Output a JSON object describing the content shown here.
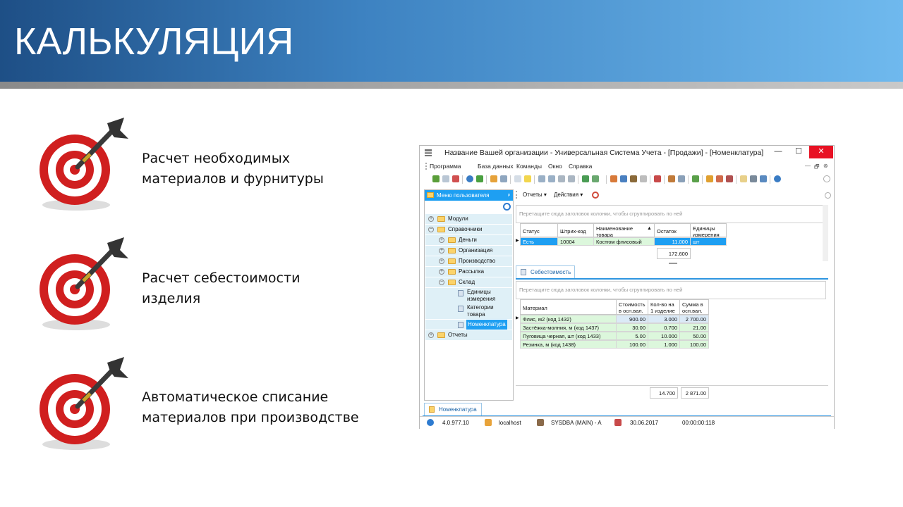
{
  "slide": {
    "title": "КАЛЬКУЛЯЦИЯ"
  },
  "bullets": [
    {
      "text": "Расчет необходимых\nматериалов и фурнитуры"
    },
    {
      "text": "Расчет себестоимости\nизделия"
    },
    {
      "text": "Автоматическое списание\nматериалов при производстве"
    }
  ],
  "app": {
    "title": "Название Вашей организации - Универсальная Система Учета - [Продажи] - [Номенклатура]",
    "window_buttons": {
      "minimize": "—",
      "maximize": "☐",
      "close": "✕"
    },
    "menu": [
      "Программа",
      "База данных",
      "Команды",
      "Окно",
      "Справка"
    ],
    "mdi_buttons": {
      "minimize": "—",
      "restore": "🗗",
      "close": "⊗"
    },
    "left_panel": {
      "header": "Меню пользователя",
      "pin": "ᵖ",
      "tree": [
        {
          "label": "Модули",
          "toggle": "+"
        },
        {
          "label": "Справочники",
          "toggle": "−"
        },
        {
          "label": "Деньги",
          "toggle": "+"
        },
        {
          "label": "Организация",
          "toggle": "+"
        },
        {
          "label": "Производство",
          "toggle": "+"
        },
        {
          "label": "Рассылка",
          "toggle": "+"
        },
        {
          "label": "Склад",
          "toggle": "−"
        },
        {
          "label": "Единицы\nизмерения"
        },
        {
          "label": "Категории\nтовара"
        },
        {
          "label": "Номенклатура"
        },
        {
          "label": "Отчеты",
          "toggle": "+"
        }
      ]
    },
    "right_toolbar": {
      "reports": "Отчеты ▾",
      "actions": "Действия ▾"
    },
    "top_grid": {
      "group_hint": "Перетащите сюда заголовок колонки, чтобы сгруппировать по ней",
      "headers": [
        "Статус",
        "Штрих-код",
        "Наименование\nтовара",
        "Остаток",
        "Единицы\nизмерения"
      ],
      "rows": [
        [
          "Есть",
          "10004",
          "Костюм флисовый",
          "11.000",
          "шт"
        ]
      ],
      "total": "172.600",
      "sort_indicator": "▲"
    },
    "tabs": {
      "cost_tab": "Себестоимость",
      "bottom_tab": "Номенклатура"
    },
    "bottom_grid": {
      "group_hint": "Перетащите сюда заголовок колонки, чтобы сгруппировать по ней",
      "headers": [
        "Материал",
        "Стоимость\nв осн.вал.",
        "Кол-во на\n1 изделие",
        "Сумма в\nосн.вал."
      ],
      "rows": [
        [
          "Флис, м2 (код 1432)",
          "900.00",
          "3.000",
          "2 700.00"
        ],
        [
          "Застёжка-молния, м (код 1437)",
          "30.00",
          "0.700",
          "21.00"
        ],
        [
          "Пуговица черная, шт (код 1433)",
          "5.00",
          "10.000",
          "50.00"
        ],
        [
          "Резинка, м (код 1438)",
          "100.00",
          "1.000",
          "100.00"
        ]
      ],
      "totals": [
        "14.700",
        "2 871.00"
      ]
    },
    "status": {
      "version": "4.0.977.10",
      "server": "localhost",
      "user": "SYSDBA (MAIN) - A",
      "date": "30.06.2017",
      "time": "00:00:00:118"
    }
  },
  "colors": {
    "accent": "#1e9ff2",
    "row_green": "#dcf7dc",
    "header_start": "#1e4f86",
    "header_end": "#6fb9ee"
  }
}
